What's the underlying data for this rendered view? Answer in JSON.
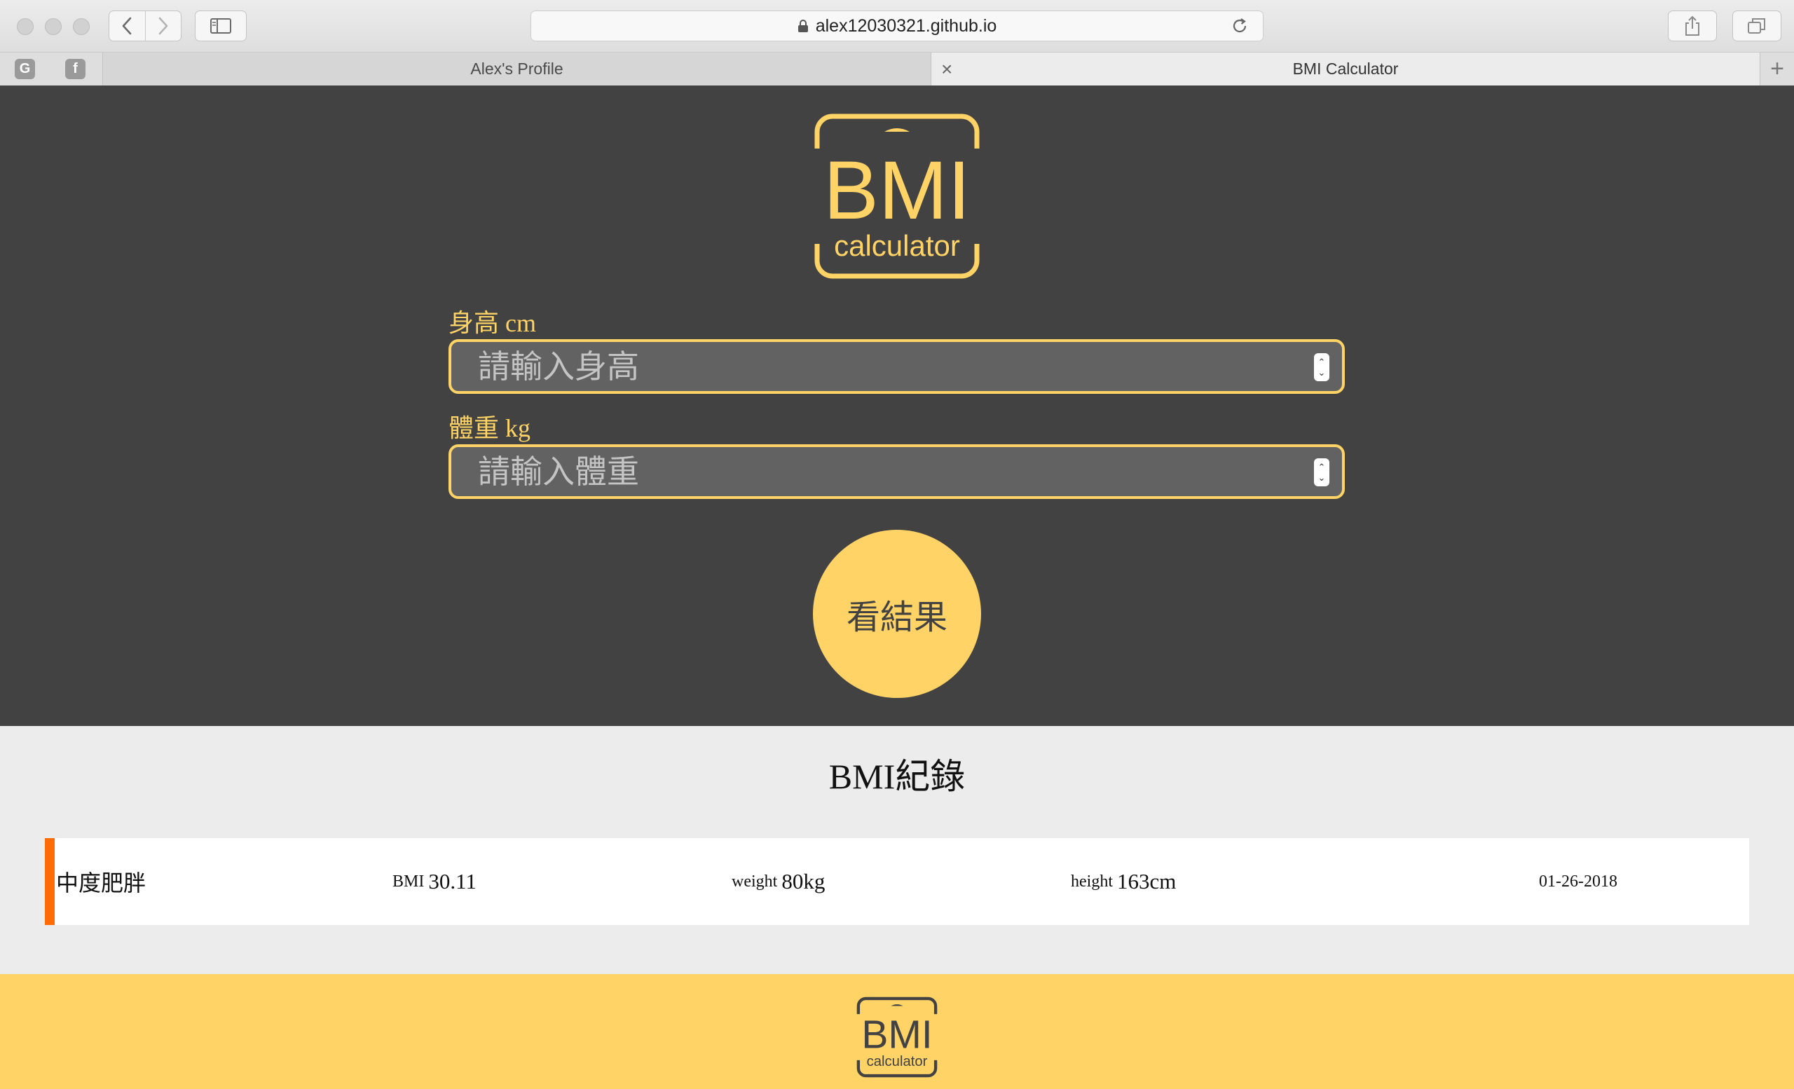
{
  "browser": {
    "url": "alex12030321.github.io",
    "favorites": [
      {
        "icon": "google-icon",
        "glyph": "G"
      },
      {
        "icon": "facebook-icon",
        "glyph": "f"
      }
    ],
    "tabs": [
      {
        "label": "Alex's Profile",
        "active": false
      },
      {
        "label": "BMI Calculator",
        "active": true
      }
    ]
  },
  "hero": {
    "logo": {
      "main": "BMI",
      "sub": "calculator"
    },
    "height_label": "身高 cm",
    "height_placeholder": "請輸入身高",
    "weight_label": "體重 kg",
    "weight_placeholder": "請輸入體重",
    "result_button": "看結果"
  },
  "records": {
    "title": "BMI紀錄",
    "items": [
      {
        "status": "中度肥胖",
        "bmi_label": "BMI",
        "bmi_value": "30.11",
        "weight_label": "weight",
        "weight_value": "80kg",
        "height_label": "height",
        "height_value": "163cm",
        "date": "01-26-2018",
        "status_color": "#ff6c03"
      }
    ]
  },
  "footer": {
    "logo": {
      "main": "BMI",
      "sub": "calculator"
    }
  },
  "colors": {
    "accent": "#ffd366",
    "hero_bg": "#424242",
    "records_bg": "#ececec",
    "warning": "#ff6c03"
  }
}
